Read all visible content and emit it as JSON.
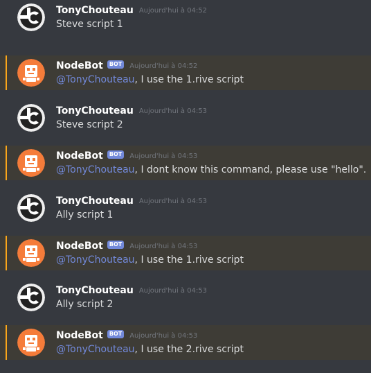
{
  "colors": {
    "background": "#36393f",
    "mention_highlight": "#3e3c36",
    "mention_bar": "#faa61a",
    "bot_tag": "#7289da",
    "mention_text": "#7289da",
    "username": "#ffffff",
    "message_text": "#dcddde",
    "timestamp": "#72767d"
  },
  "messages": [
    {
      "author": "TonyChouteau",
      "avatar_icon": "tonychouteau-logo-icon",
      "timestamp": "Aujourd'hui à 04:52",
      "text": "Steve script 1"
    },
    {
      "author": "NodeBot",
      "bot_tag": "BOT",
      "avatar_icon": "nodebot-robot-icon",
      "timestamp": "Aujourd'hui à 04:52",
      "mention": "@TonyChouteau",
      "text": ", I use the 1.rive script"
    },
    {
      "author": "TonyChouteau",
      "avatar_icon": "tonychouteau-logo-icon",
      "timestamp": "Aujourd'hui à 04:53",
      "text": "Steve script 2"
    },
    {
      "author": "NodeBot",
      "bot_tag": "BOT",
      "avatar_icon": "nodebot-robot-icon",
      "timestamp": "Aujourd'hui à 04:53",
      "mention": "@TonyChouteau",
      "text": ", I dont know this command, please use \"hello\"."
    },
    {
      "author": "TonyChouteau",
      "avatar_icon": "tonychouteau-logo-icon",
      "timestamp": "Aujourd'hui à 04:53",
      "text": "Ally script 1"
    },
    {
      "author": "NodeBot",
      "bot_tag": "BOT",
      "avatar_icon": "nodebot-robot-icon",
      "timestamp": "Aujourd'hui à 04:53",
      "mention": "@TonyChouteau",
      "text": ", I use the 1.rive script"
    },
    {
      "author": "TonyChouteau",
      "avatar_icon": "tonychouteau-logo-icon",
      "timestamp": "Aujourd'hui à 04:53",
      "text": "Ally script 2"
    },
    {
      "author": "NodeBot",
      "bot_tag": "BOT",
      "avatar_icon": "nodebot-robot-icon",
      "timestamp": "Aujourd'hui à 04:53",
      "mention": "@TonyChouteau",
      "text": ", I use the 2.rive script"
    }
  ]
}
